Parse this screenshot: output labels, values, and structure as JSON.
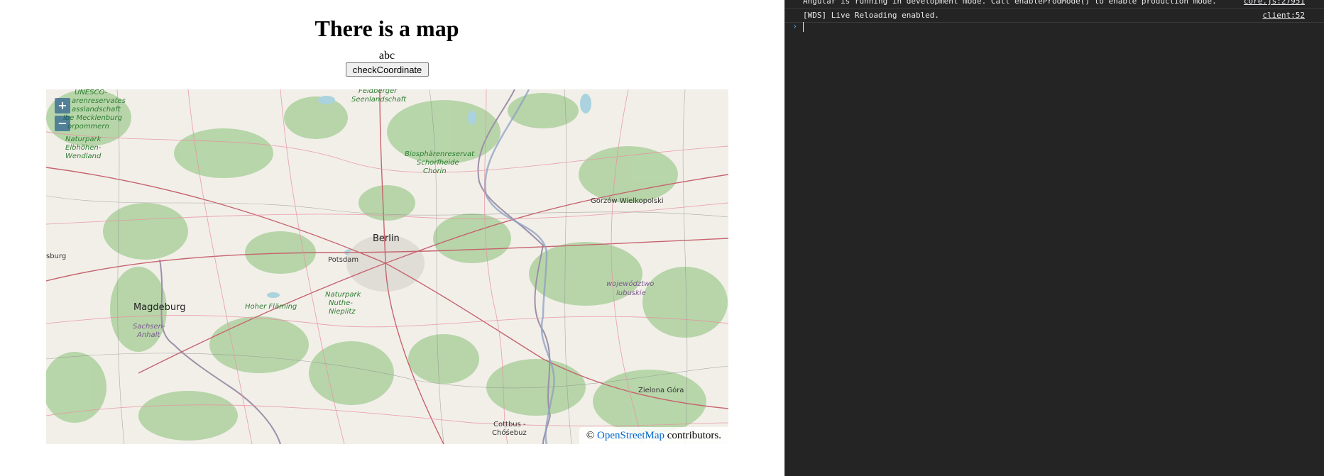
{
  "page": {
    "title": "There is a map",
    "subtext": "abc",
    "button_label": "checkCoordinate"
  },
  "map": {
    "zoom_in_label": "+",
    "zoom_out_label": "−",
    "attribution": {
      "prefix": "©",
      "link_text": "OpenStreetMap",
      "suffix": "contributors."
    },
    "places": {
      "unesco": [
        "UNESCO-",
        "arenreservates",
        "asslandschaft",
        "lbe Mecklenburg",
        "orpommern"
      ],
      "feldberger": [
        "Feldberger",
        "Seenlandschaft"
      ],
      "elbhoehen": [
        "Naturpark",
        "Elbhöhen-",
        "Wendland"
      ],
      "schorfheide": [
        "Biosphärenreservat",
        "Schorfheide",
        "Chorin"
      ],
      "gorzow": "Gorzów Wielkopolski",
      "berlin": "Berlin",
      "potsdam": "Potsdam",
      "sburg": "sburg",
      "magdeburg": "Magdeburg",
      "hoher_flaeming": "Hoher Fläming",
      "nuthe": [
        "Naturpark",
        "Nuthe-",
        "Nieplitz"
      ],
      "lubuskie": [
        "województwo",
        "lubuskie"
      ],
      "sachsen_anhalt": [
        "Sachsen-",
        "Anhalt"
      ],
      "zielona_gora": "Zielona Góra",
      "cottbus": [
        "Cottbus -",
        "Chóśebuz"
      ]
    },
    "colors": {
      "land": "#f2efe9",
      "forest": "#add19e",
      "road": "#e892a2",
      "highway": "#c6646e",
      "border": "#9e8fa8",
      "water": "#aad3df"
    }
  },
  "console": {
    "logs": [
      {
        "message": "Angular is running in development mode. Call enableProdMode() to enable production mode.",
        "source": "core.js:27951"
      },
      {
        "message": "[WDS] Live Reloading enabled.",
        "source": "client:52"
      }
    ],
    "prompt_symbol": "›"
  }
}
